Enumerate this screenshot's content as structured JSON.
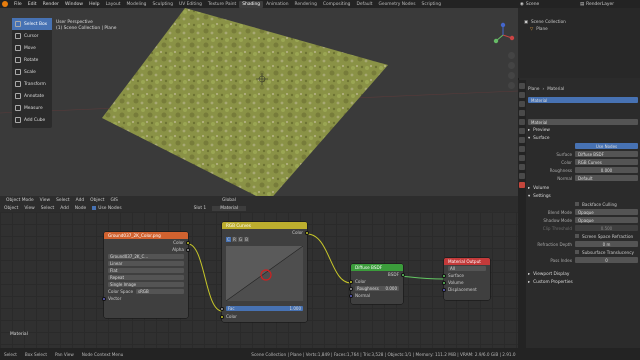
{
  "topbar": {
    "menus": [
      "File",
      "Edit",
      "Render",
      "Window",
      "Help"
    ],
    "workspaces": [
      "Layout",
      "Modeling",
      "Sculpting",
      "UV Editing",
      "Texture Paint",
      "Shading",
      "Animation",
      "Rendering",
      "Compositing",
      "Default",
      "Geometry Nodes",
      "Scripting"
    ],
    "active_workspace": "Shading",
    "scene_label": "Scene",
    "layer_label": "RenderLayer"
  },
  "viewport": {
    "info_line1": "User Perspective",
    "info_line2": "(1) Scene Collection | Plane",
    "tools": [
      {
        "label": "Select Box",
        "active": true
      },
      {
        "label": "Cursor",
        "active": false
      },
      {
        "label": "Move",
        "active": false
      },
      {
        "label": "Rotate",
        "active": false
      },
      {
        "label": "Scale",
        "active": false
      },
      {
        "label": "Transform",
        "active": false
      },
      {
        "label": "Annotate",
        "active": false
      },
      {
        "label": "Measure",
        "active": false
      },
      {
        "label": "Add Cube",
        "active": false
      }
    ],
    "toolbar": [
      "Object Mode",
      "View",
      "Select",
      "Add",
      "Object",
      "GIS"
    ],
    "global_label": "Global"
  },
  "node_editor": {
    "header": [
      "Object",
      "View",
      "Select",
      "Add",
      "Node",
      "Use Nodes"
    ],
    "slot_label": "Slot 1",
    "material_label": "Material",
    "bottom_label": "Material",
    "image_node": {
      "title": "Ground037_2K_Color.png",
      "out_color": "Color",
      "out_alpha": "Alpha",
      "image_name": "Ground037_2K_C...",
      "interpolation": "Linear",
      "projection": "Flat",
      "extension": "Repeat",
      "source": "Single Image",
      "color_space_label": "Color Space",
      "color_space": "sRGB",
      "vector": "Vector"
    },
    "rgb_node": {
      "title": "RGB Curves",
      "out_color": "Color",
      "channels": [
        "C",
        "R",
        "G",
        "B"
      ],
      "fac_label": "Fac",
      "fac_value": "1.000",
      "in_color": "Color"
    },
    "bsdf_node": {
      "title": "Diffuse BSDF",
      "out_bsdf": "BSDF",
      "in_color": "Color",
      "roughness_label": "Roughness",
      "roughness_value": "0.000",
      "in_normal": "Normal"
    },
    "output_node": {
      "title": "Material Output",
      "target": "All",
      "in_surface": "Surface",
      "in_volume": "Volume",
      "in_displacement": "Displacement"
    }
  },
  "outliner": {
    "root": "Scene Collection",
    "items": [
      "Plane"
    ]
  },
  "properties": {
    "breadcrumb": [
      "Plane",
      "Material"
    ],
    "material_slot": "Material",
    "material_name": "Material",
    "sections": {
      "preview": "Preview",
      "surface": "Surface",
      "volume": "Volume",
      "settings": "Settings",
      "viewport_display": "Viewport Display",
      "custom_properties": "Custom Properties"
    },
    "use_nodes_btn": "Use Nodes",
    "surface_label": "Surface",
    "surface_value": "Diffuse BSDF",
    "color_label": "Color",
    "color_value": "RGB Curves",
    "roughness_label": "Roughness",
    "roughness_value": "0.000",
    "normal_label": "Normal",
    "normal_value": "Default",
    "backface_culling": "Backface Culling",
    "blend_mode_label": "Blend Mode",
    "blend_mode": "Opaque",
    "shadow_mode_label": "Shadow Mode",
    "shadow_mode": "Opaque",
    "clip_threshold_label": "Clip Threshold",
    "clip_threshold": "0.500",
    "ssr": "Screen Space Refraction",
    "refraction_depth_label": "Refraction Depth",
    "refraction_depth": "0 m",
    "sss": "Subsurface Translucency",
    "pass_index_label": "Pass Index",
    "pass_index": "0"
  },
  "statusbar": {
    "items": [
      "Select",
      "Box Select",
      "Pan View",
      "Node Context Menu"
    ],
    "stats": "Scene Collection | Plane | Verts:1,849 | Faces:1,764 | Tris:3,528 | Objects:1/1 | Memory: 111.2 MiB | VRAM: 2.9/6.0 GiB | 2.91.0"
  },
  "colors": {
    "accent": "#4772b3",
    "image_node_header": "#d1622f",
    "rgb_node_header": "#bdae2e",
    "bsdf_node_header": "#3b9c3b",
    "output_node_header": "#c43a3a",
    "socket_color": "#c7c729",
    "socket_shader": "#63c763",
    "socket_vector": "#6363c7",
    "socket_float": "#a1a1a1"
  }
}
